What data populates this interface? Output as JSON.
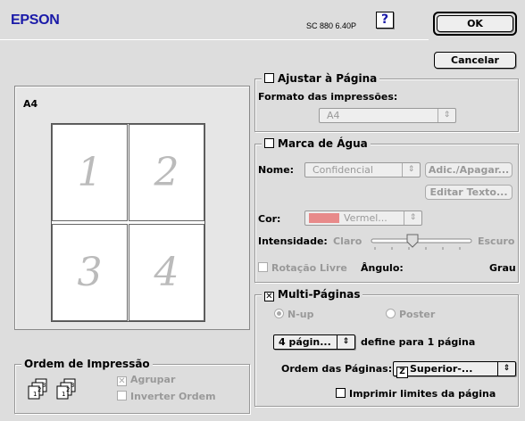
{
  "header": {
    "logo": "EPSON",
    "version": "SC 880 6.40P",
    "help_label": "?",
    "ok_label": "OK",
    "cancel_label": "Cancelar"
  },
  "preview": {
    "paper_size": "A4",
    "pages": [
      "1",
      "2",
      "3",
      "4"
    ]
  },
  "print_order": {
    "title": "Ordem de Impressão",
    "collate_label": "Agrupar",
    "collate_checked": true,
    "reverse_label": "Inverter Ordem",
    "reverse_checked": false,
    "icon_pages": [
      "1",
      "2",
      "3"
    ]
  },
  "fit_to_page": {
    "title": "Ajustar à Página",
    "checked": false,
    "format_label": "Formato das impressões:",
    "format_value": "A4"
  },
  "watermark": {
    "title": "Marca de Água",
    "checked": false,
    "name_label": "Nome:",
    "name_value": "Confidencial",
    "add_delete_label": "Adic./Apagar...",
    "edit_text_label": "Editar Texto...",
    "color_label": "Cor:",
    "color_value": "Vermel...",
    "color_swatch": "#e88a8a",
    "intensity_label": "Intensidade:",
    "intensity_light": "Claro",
    "intensity_dark": "Escuro",
    "intensity_level": 0.4,
    "free_rotation_label": "Rotação Livre",
    "free_rotation_checked": false,
    "angle_label": "Ângulo:",
    "degree_label": "Grau"
  },
  "multi_page": {
    "title": "Multi-Páginas",
    "checked": true,
    "nup_label": "N-up",
    "nup_selected": true,
    "poster_label": "Poster",
    "pages_value": "4 págin...",
    "pages_suffix": "define para 1 página",
    "order_label": "Ordem das Páginas:",
    "order_value": "Superior-...",
    "print_borders_label": "Imprimir limites da página",
    "print_borders_checked": false
  }
}
